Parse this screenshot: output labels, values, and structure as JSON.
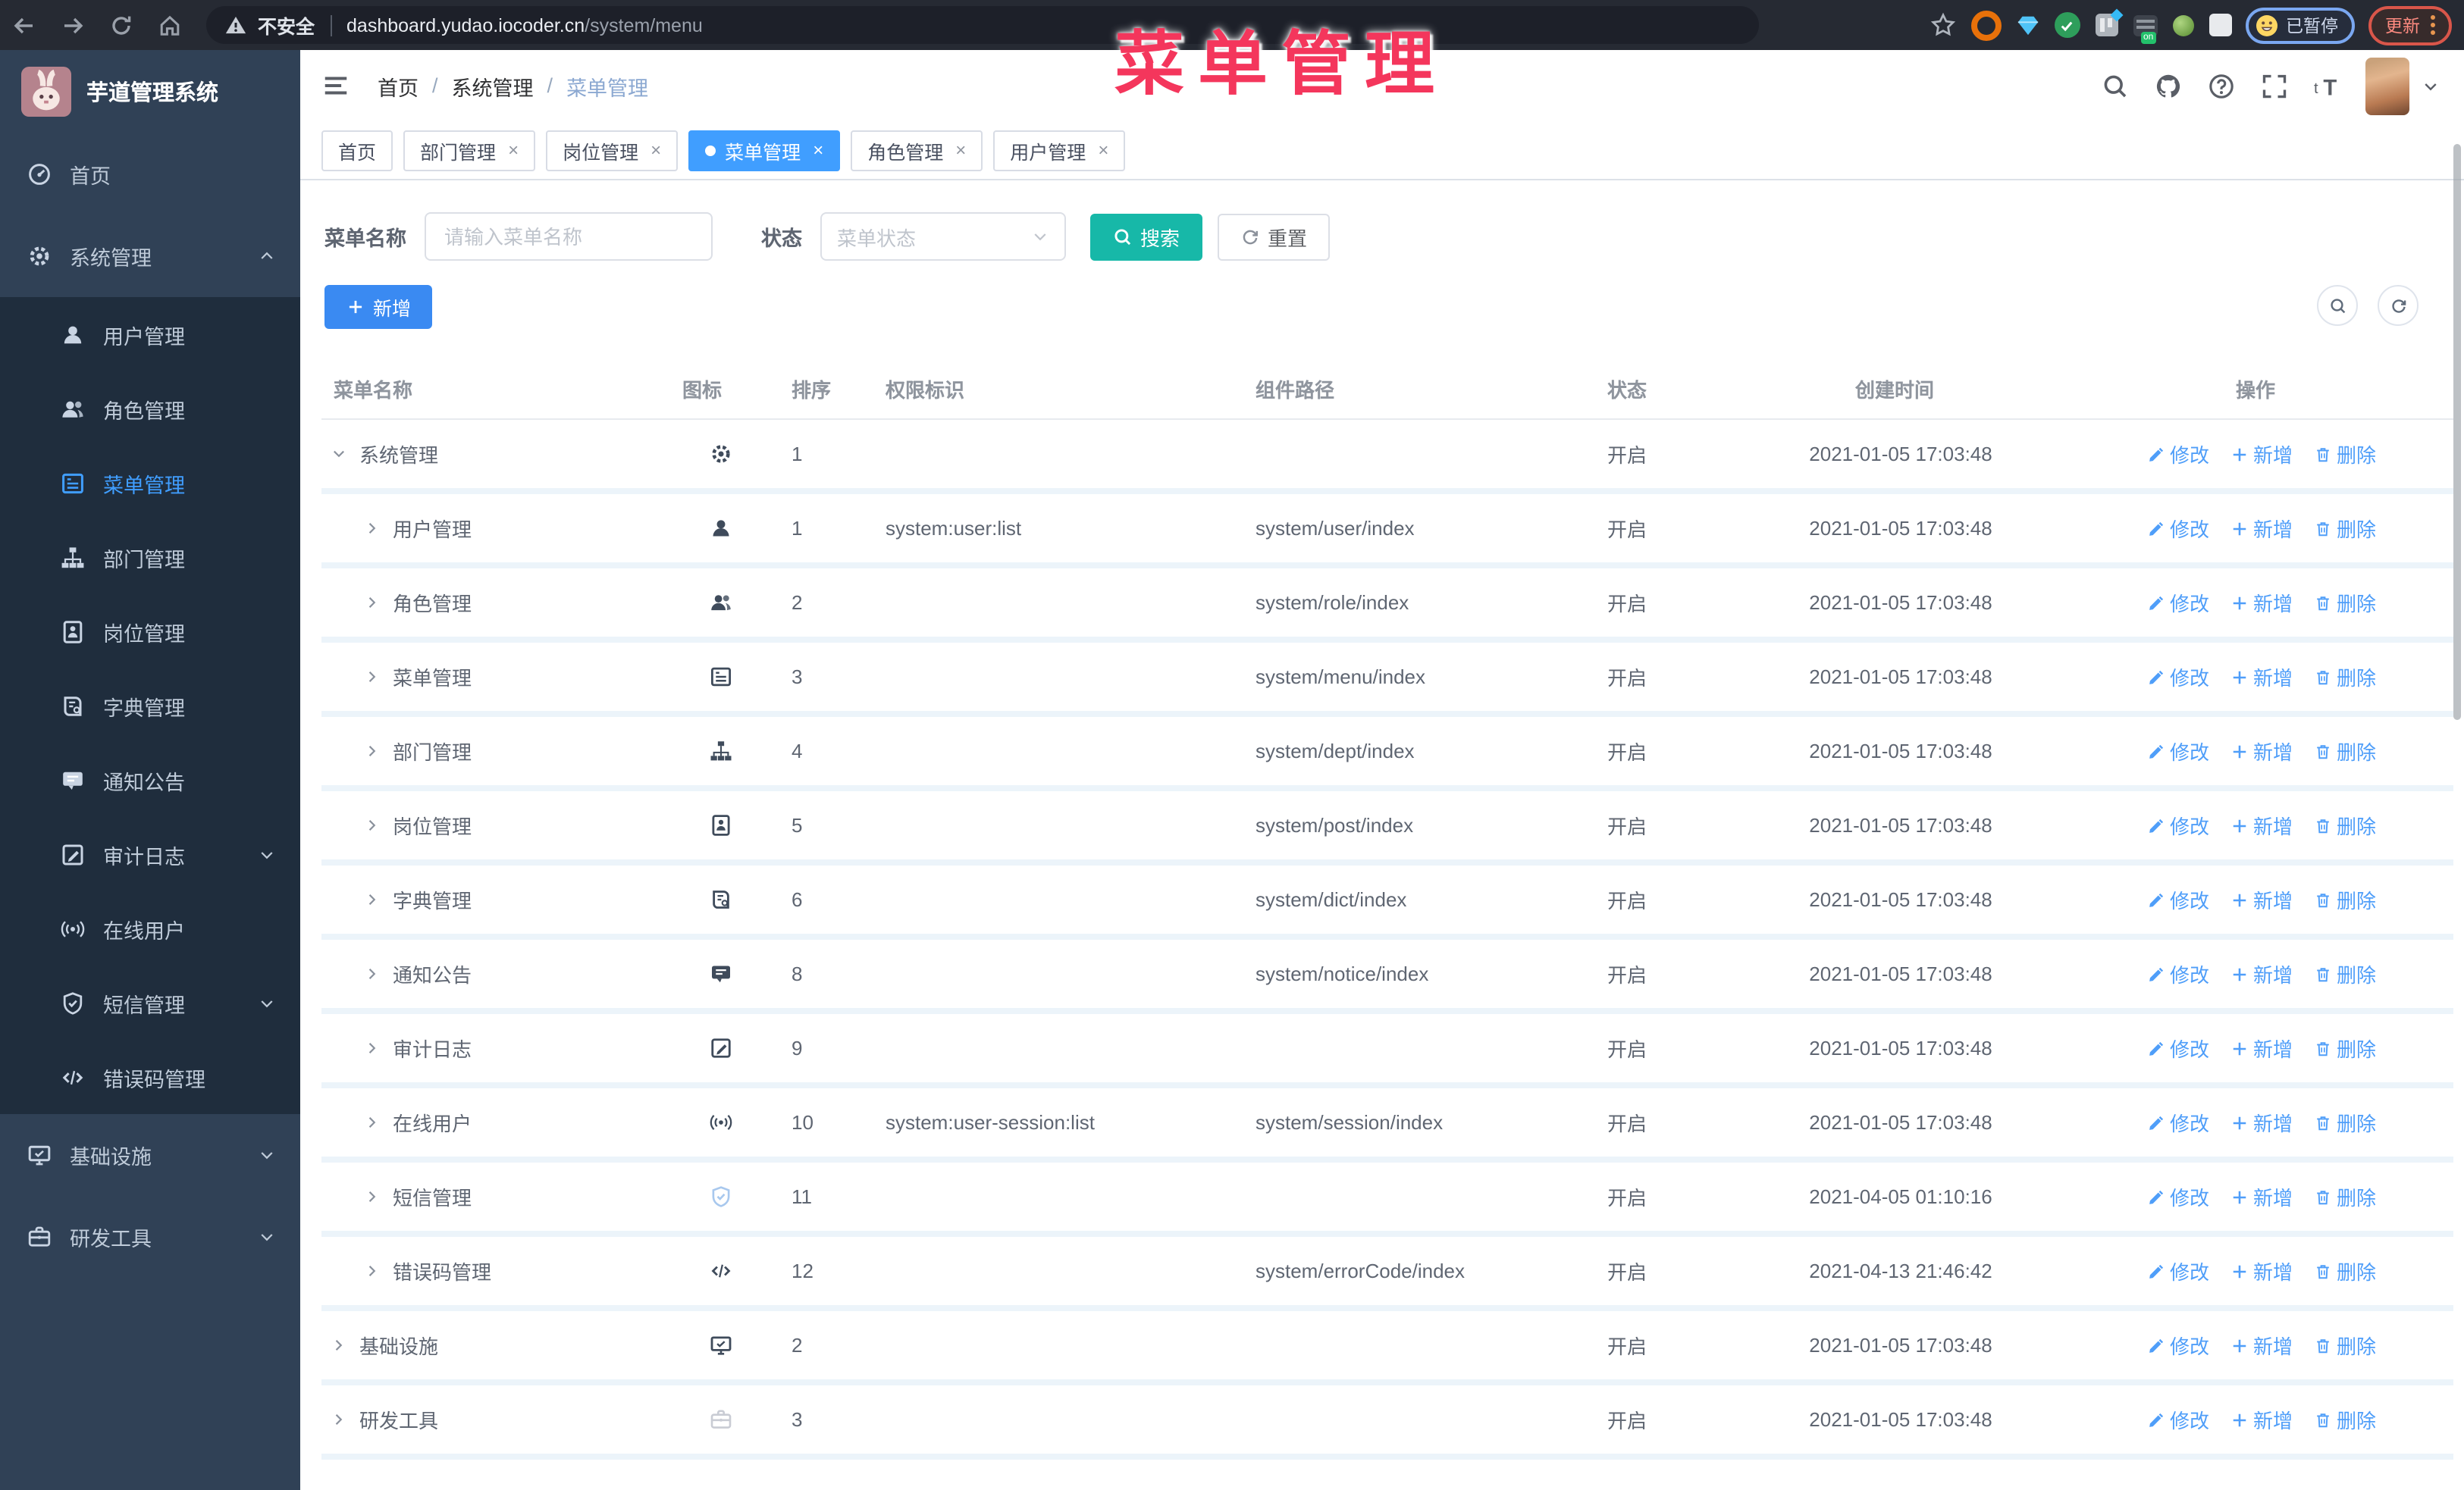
{
  "browser": {
    "security_label": "不安全",
    "url_host": "dashboard.yudao.iocoder.cn",
    "url_path": "/system/menu",
    "paused_chip": "已暂停",
    "update_label": "更新",
    "extension_badge": "on",
    "extension_icons": [
      "bookmark-star",
      "orange-ring",
      "blue-gem",
      "green-check",
      "gray-grid",
      "dark-list-on",
      "green-dot",
      "puzzle"
    ]
  },
  "annotation": {
    "text": "菜单管理",
    "color": "#f4365c"
  },
  "sidebar": {
    "title": "芋道管理系统",
    "menu": [
      {
        "key": "home",
        "label": "首页",
        "icon": "home"
      },
      {
        "key": "system",
        "label": "系统管理",
        "icon": "gear",
        "chevron": "up",
        "children": [
          {
            "key": "user",
            "label": "用户管理",
            "icon": "user"
          },
          {
            "key": "role",
            "label": "角色管理",
            "icon": "users"
          },
          {
            "key": "menu",
            "label": "菜单管理",
            "icon": "menu",
            "active": true
          },
          {
            "key": "dept",
            "label": "部门管理",
            "icon": "tree"
          },
          {
            "key": "post",
            "label": "岗位管理",
            "icon": "post"
          },
          {
            "key": "dict",
            "label": "字典管理",
            "icon": "dict"
          },
          {
            "key": "notice",
            "label": "通知公告",
            "icon": "notice"
          },
          {
            "key": "audit-log",
            "label": "审计日志",
            "icon": "log",
            "chevron": "down"
          },
          {
            "key": "online-user",
            "label": "在线用户",
            "icon": "online"
          },
          {
            "key": "sms",
            "label": "短信管理",
            "icon": "sms",
            "chevron": "down"
          },
          {
            "key": "error-code",
            "label": "错误码管理",
            "icon": "code"
          }
        ]
      },
      {
        "key": "infra",
        "label": "基础设施",
        "icon": "monitor",
        "chevron": "down"
      },
      {
        "key": "devtools",
        "label": "研发工具",
        "icon": "tool",
        "chevron": "down"
      }
    ]
  },
  "header": {
    "breadcrumb": [
      "首页",
      "系统管理",
      "菜单管理"
    ]
  },
  "tabs": [
    {
      "label": "首页",
      "closable": false,
      "active": false
    },
    {
      "label": "部门管理",
      "closable": true,
      "active": false
    },
    {
      "label": "岗位管理",
      "closable": true,
      "active": false
    },
    {
      "label": "菜单管理",
      "closable": true,
      "active": true
    },
    {
      "label": "角色管理",
      "closable": true,
      "active": false
    },
    {
      "label": "用户管理",
      "closable": true,
      "active": false
    }
  ],
  "filters": {
    "name_label": "菜单名称",
    "name_placeholder": "请输入菜单名称",
    "name_value": "",
    "status_label": "状态",
    "status_placeholder": "菜单状态",
    "search_label": "搜索",
    "reset_label": "重置"
  },
  "toolbar": {
    "add_label": "新增"
  },
  "table": {
    "columns": [
      "菜单名称",
      "图标",
      "排序",
      "权限标识",
      "组件路径",
      "状态",
      "创建时间",
      "操作"
    ],
    "op_labels": [
      "修改",
      "新增",
      "删除"
    ],
    "rows": [
      {
        "name": "系统管理",
        "icon": "gear",
        "level": 0,
        "caret": "down",
        "sort": "1",
        "perm": "",
        "path": "",
        "status": "开启",
        "time": "2021-01-05 17:03:48"
      },
      {
        "name": "用户管理",
        "icon": "user",
        "level": 1,
        "caret": "right",
        "sort": "1",
        "perm": "system:user:list",
        "path": "system/user/index",
        "status": "开启",
        "time": "2021-01-05 17:03:48"
      },
      {
        "name": "角色管理",
        "icon": "users",
        "level": 1,
        "caret": "right",
        "sort": "2",
        "perm": "",
        "path": "system/role/index",
        "status": "开启",
        "time": "2021-01-05 17:03:48"
      },
      {
        "name": "菜单管理",
        "icon": "menu",
        "level": 1,
        "caret": "right",
        "sort": "3",
        "perm": "",
        "path": "system/menu/index",
        "status": "开启",
        "time": "2021-01-05 17:03:48"
      },
      {
        "name": "部门管理",
        "icon": "tree",
        "level": 1,
        "caret": "right",
        "sort": "4",
        "perm": "",
        "path": "system/dept/index",
        "status": "开启",
        "time": "2021-01-05 17:03:48"
      },
      {
        "name": "岗位管理",
        "icon": "post",
        "level": 1,
        "caret": "right",
        "sort": "5",
        "perm": "",
        "path": "system/post/index",
        "status": "开启",
        "time": "2021-01-05 17:03:48"
      },
      {
        "name": "字典管理",
        "icon": "dict",
        "level": 1,
        "caret": "right",
        "sort": "6",
        "perm": "",
        "path": "system/dict/index",
        "status": "开启",
        "time": "2021-01-05 17:03:48"
      },
      {
        "name": "通知公告",
        "icon": "notice",
        "level": 1,
        "caret": "right",
        "sort": "8",
        "perm": "",
        "path": "system/notice/index",
        "status": "开启",
        "time": "2021-01-05 17:03:48"
      },
      {
        "name": "审计日志",
        "icon": "log",
        "level": 1,
        "caret": "right",
        "sort": "9",
        "perm": "",
        "path": "",
        "status": "开启",
        "time": "2021-01-05 17:03:48"
      },
      {
        "name": "在线用户",
        "icon": "online",
        "level": 1,
        "caret": "right",
        "sort": "10",
        "perm": "system:user-session:list",
        "path": "system/session/index",
        "status": "开启",
        "time": "2021-01-05 17:03:48"
      },
      {
        "name": "短信管理",
        "icon": "sms",
        "level": 1,
        "caret": "right",
        "sort": "11",
        "perm": "",
        "path": "",
        "status": "开启",
        "time": "2021-04-05 01:10:16",
        "icon_style": "lite"
      },
      {
        "name": "错误码管理",
        "icon": "code",
        "level": 1,
        "caret": "right",
        "sort": "12",
        "perm": "",
        "path": "system/errorCode/index",
        "status": "开启",
        "time": "2021-04-13 21:46:42"
      },
      {
        "name": "基础设施",
        "icon": "monitor",
        "level": 0,
        "caret": "right",
        "sort": "2",
        "perm": "",
        "path": "",
        "status": "开启",
        "time": "2021-01-05 17:03:48"
      },
      {
        "name": "研发工具",
        "icon": "tool",
        "level": 0,
        "caret": "right",
        "sort": "3",
        "perm": "",
        "path": "",
        "status": "开启",
        "time": "2021-01-05 17:03:48",
        "icon_style": "ghost"
      }
    ]
  },
  "colors": {
    "accent": "#409eff",
    "search_button": "#17b8a8",
    "add_button": "#3a8af2",
    "annotation": "#f4365c",
    "sidebar_bg": "#304156",
    "submenu_bg": "#1f2d3d"
  }
}
